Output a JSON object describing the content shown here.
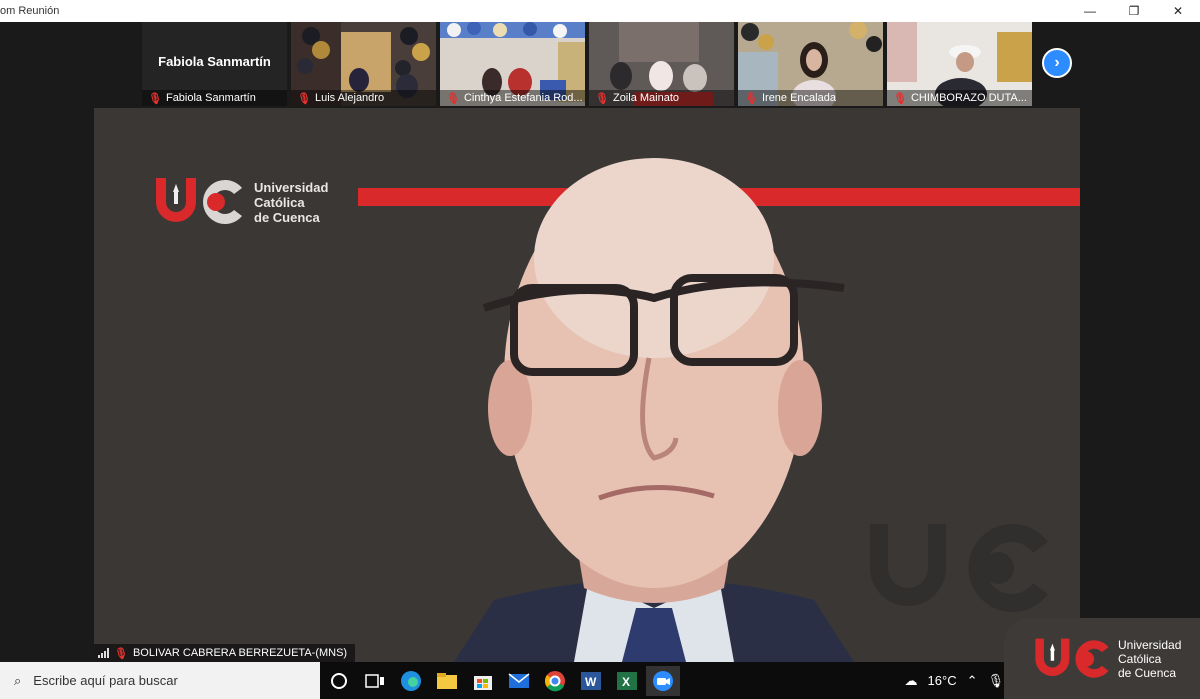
{
  "window": {
    "title": "om Reunión",
    "minimize": "—",
    "restore": "❐",
    "close": "✕"
  },
  "strip": {
    "thumbs": [
      {
        "name": "Fabiola Sanmartín",
        "label": "Fabiola Sanmartín",
        "muted": true,
        "video": false
      },
      {
        "name": "Luis Alejandro",
        "label": "Luis Alejandro",
        "muted": true,
        "video": true
      },
      {
        "name": "Cinthya Estefania Rod...",
        "label": "Cinthya Estefania Rod...",
        "muted": true,
        "video": true
      },
      {
        "name": "Zoila Mainato",
        "label": "Zoila Mainato",
        "muted": true,
        "video": true
      },
      {
        "name": "Irene Encalada",
        "label": "Irene Encalada",
        "muted": true,
        "video": true
      },
      {
        "name": "CHIMBORAZO DUTA...",
        "label": "CHIMBORAZO DUTA...",
        "muted": true,
        "video": true
      }
    ],
    "next_icon": "chevron-right-icon"
  },
  "main": {
    "logo_lines": [
      "Universidad",
      "Católica",
      "de Cuenca"
    ],
    "speaker_name": "BOLIVAR CABRERA BERREZUETA-(MNS)",
    "accent_red": "#d9292b",
    "background": "#3a3735"
  },
  "taskbar": {
    "search_placeholder": "Escribe aquí para buscar",
    "apps": [
      "cortana-icon",
      "task-view-icon",
      "edge-icon",
      "file-explorer-icon",
      "store-icon",
      "mail-icon",
      "chrome-icon",
      "word-icon",
      "excel-icon",
      "zoom-icon"
    ],
    "weather": "16°C"
  },
  "corner_logo": {
    "lines": [
      "Universidad",
      "Católica",
      "de Cuenca"
    ]
  }
}
